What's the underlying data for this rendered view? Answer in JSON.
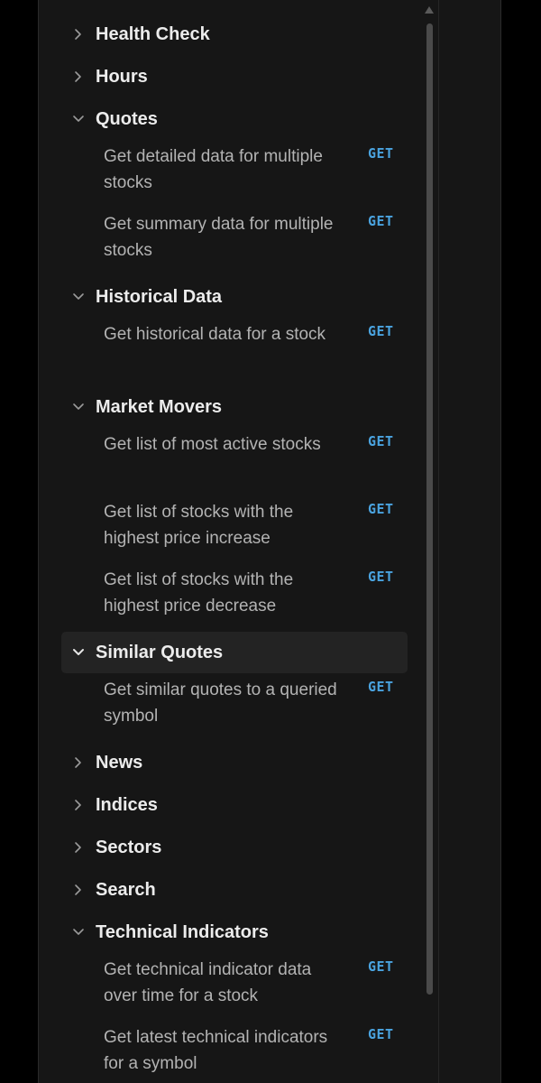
{
  "sidebar": {
    "method_label": "GET",
    "sections": [
      {
        "label": "Health Check",
        "expanded": false,
        "endpoints": []
      },
      {
        "label": "Hours",
        "expanded": false,
        "endpoints": []
      },
      {
        "label": "Quotes",
        "expanded": true,
        "endpoints": [
          {
            "label": "Get detailed data for multiple stocks",
            "method": "GET"
          },
          {
            "label": "Get summary data for multiple stocks",
            "method": "GET"
          }
        ]
      },
      {
        "label": "Historical Data",
        "expanded": true,
        "endpoints": [
          {
            "label": "Get historical data for a stock",
            "method": "GET"
          }
        ]
      },
      {
        "label": "Market Movers",
        "expanded": true,
        "endpoints": [
          {
            "label": "Get list of most active stocks",
            "method": "GET"
          },
          {
            "label": "Get list of stocks with the highest price increase",
            "method": "GET"
          },
          {
            "label": "Get list of stocks with the highest price decrease",
            "method": "GET"
          }
        ]
      },
      {
        "label": "Similar Quotes",
        "expanded": true,
        "active": true,
        "endpoints": [
          {
            "label": "Get similar quotes to a queried symbol",
            "method": "GET"
          }
        ]
      },
      {
        "label": "News",
        "expanded": false,
        "endpoints": []
      },
      {
        "label": "Indices",
        "expanded": false,
        "endpoints": []
      },
      {
        "label": "Sectors",
        "expanded": false,
        "endpoints": []
      },
      {
        "label": "Search",
        "expanded": false,
        "endpoints": []
      },
      {
        "label": "Technical Indicators",
        "expanded": true,
        "endpoints": [
          {
            "label": "Get technical indicator data over time for a stock",
            "method": "GET"
          },
          {
            "label": "Get latest technical indicators for a symbol",
            "method": "GET"
          }
        ]
      }
    ]
  },
  "colors": {
    "background": "#161616",
    "section_text": "#ececec",
    "endpoint_text": "#b3b3b3",
    "method_get": "#4aa3df",
    "active_row": "#232323"
  },
  "icons": {
    "collapsed": "chevron-right-icon",
    "expanded": "chevron-down-icon"
  }
}
